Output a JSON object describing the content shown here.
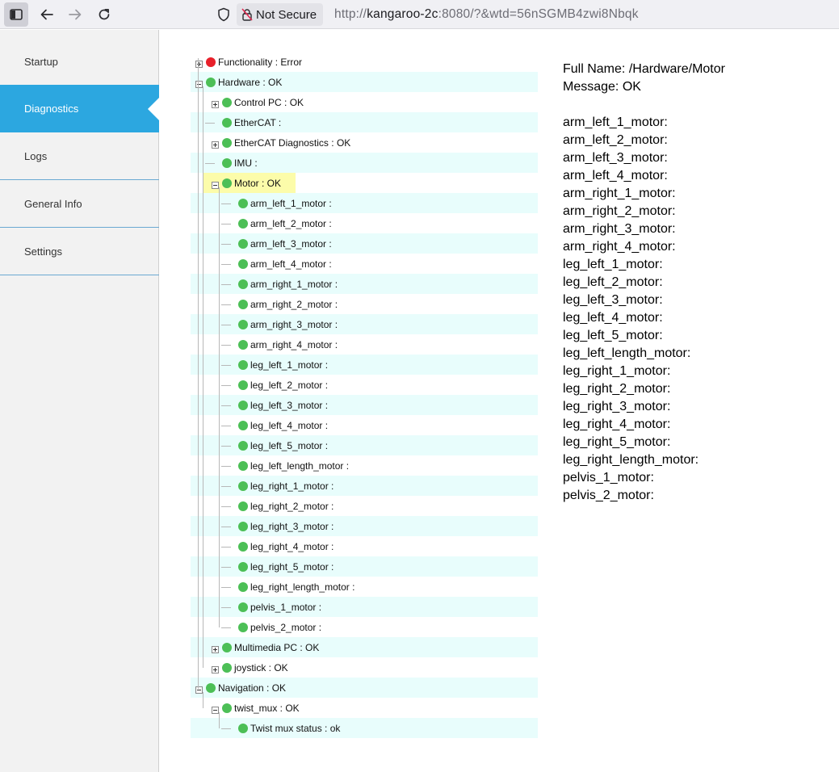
{
  "browser": {
    "security_label": "Not Secure",
    "url_prefix": "http://",
    "url_host": "kangaroo-2c",
    "url_rest": ":8080/?&wtd=56nSGMB4zwi8Nbqk"
  },
  "sidebar": {
    "items": [
      {
        "label": "Startup"
      },
      {
        "label": "Diagnostics"
      },
      {
        "label": "Logs"
      },
      {
        "label": "General Info"
      },
      {
        "label": "Settings"
      }
    ]
  },
  "tree": {
    "rows": [
      {
        "label": "Functionality : Error",
        "status": "error",
        "depth": 0,
        "toggle": "plus"
      },
      {
        "label": "Hardware : OK",
        "status": "ok",
        "depth": 0,
        "toggle": "minus"
      },
      {
        "label": "Control PC : OK",
        "status": "ok",
        "depth": 1,
        "toggle": "plus"
      },
      {
        "label": "EtherCAT :",
        "status": "ok",
        "depth": 1,
        "toggle": "none"
      },
      {
        "label": "EtherCAT Diagnostics : OK",
        "status": "ok",
        "depth": 1,
        "toggle": "plus"
      },
      {
        "label": "IMU :",
        "status": "ok",
        "depth": 1,
        "toggle": "none"
      },
      {
        "label": "Motor : OK",
        "status": "ok",
        "depth": 1,
        "toggle": "minus",
        "selected": true
      },
      {
        "label": "arm_left_1_motor :",
        "status": "ok",
        "depth": 2,
        "toggle": "none"
      },
      {
        "label": "arm_left_2_motor :",
        "status": "ok",
        "depth": 2,
        "toggle": "none"
      },
      {
        "label": "arm_left_3_motor :",
        "status": "ok",
        "depth": 2,
        "toggle": "none"
      },
      {
        "label": "arm_left_4_motor :",
        "status": "ok",
        "depth": 2,
        "toggle": "none"
      },
      {
        "label": "arm_right_1_motor :",
        "status": "ok",
        "depth": 2,
        "toggle": "none"
      },
      {
        "label": "arm_right_2_motor :",
        "status": "ok",
        "depth": 2,
        "toggle": "none"
      },
      {
        "label": "arm_right_3_motor :",
        "status": "ok",
        "depth": 2,
        "toggle": "none"
      },
      {
        "label": "arm_right_4_motor :",
        "status": "ok",
        "depth": 2,
        "toggle": "none"
      },
      {
        "label": "leg_left_1_motor :",
        "status": "ok",
        "depth": 2,
        "toggle": "none"
      },
      {
        "label": "leg_left_2_motor :",
        "status": "ok",
        "depth": 2,
        "toggle": "none"
      },
      {
        "label": "leg_left_3_motor :",
        "status": "ok",
        "depth": 2,
        "toggle": "none"
      },
      {
        "label": "leg_left_4_motor :",
        "status": "ok",
        "depth": 2,
        "toggle": "none"
      },
      {
        "label": "leg_left_5_motor :",
        "status": "ok",
        "depth": 2,
        "toggle": "none"
      },
      {
        "label": "leg_left_length_motor :",
        "status": "ok",
        "depth": 2,
        "toggle": "none"
      },
      {
        "label": "leg_right_1_motor :",
        "status": "ok",
        "depth": 2,
        "toggle": "none"
      },
      {
        "label": "leg_right_2_motor :",
        "status": "ok",
        "depth": 2,
        "toggle": "none"
      },
      {
        "label": "leg_right_3_motor :",
        "status": "ok",
        "depth": 2,
        "toggle": "none"
      },
      {
        "label": "leg_right_4_motor :",
        "status": "ok",
        "depth": 2,
        "toggle": "none"
      },
      {
        "label": "leg_right_5_motor :",
        "status": "ok",
        "depth": 2,
        "toggle": "none"
      },
      {
        "label": "leg_right_length_motor :",
        "status": "ok",
        "depth": 2,
        "toggle": "none"
      },
      {
        "label": "pelvis_1_motor :",
        "status": "ok",
        "depth": 2,
        "toggle": "none"
      },
      {
        "label": "pelvis_2_motor :",
        "status": "ok",
        "depth": 2,
        "toggle": "none"
      },
      {
        "label": "Multimedia PC : OK",
        "status": "ok",
        "depth": 1,
        "toggle": "plus"
      },
      {
        "label": "joystick : OK",
        "status": "ok",
        "depth": 1,
        "toggle": "plus"
      },
      {
        "label": "Navigation : OK",
        "status": "ok",
        "depth": 0,
        "toggle": "minus"
      },
      {
        "label": "twist_mux : OK",
        "status": "ok",
        "depth": 1,
        "toggle": "minus"
      },
      {
        "label": "Twist mux status : ok",
        "status": "ok",
        "depth": 2,
        "toggle": "none"
      }
    ]
  },
  "detail": {
    "full_name_label": "Full Name:",
    "full_name_value": "/Hardware/Motor",
    "message_label": "Message:",
    "message_value": "OK",
    "entries": [
      "arm_left_1_motor:",
      "arm_left_2_motor:",
      "arm_left_3_motor:",
      "arm_left_4_motor:",
      "arm_right_1_motor:",
      "arm_right_2_motor:",
      "arm_right_3_motor:",
      "arm_right_4_motor:",
      "leg_left_1_motor:",
      "leg_left_2_motor:",
      "leg_left_3_motor:",
      "leg_left_4_motor:",
      "leg_left_5_motor:",
      "leg_left_length_motor:",
      "leg_right_1_motor:",
      "leg_right_2_motor:",
      "leg_right_3_motor:",
      "leg_right_4_motor:",
      "leg_right_5_motor:",
      "leg_right_length_motor:",
      "pelvis_1_motor:",
      "pelvis_2_motor:"
    ]
  },
  "colors": {
    "accent": "#2ca7e0",
    "status_ok": "#4cbf56",
    "status_error": "#e8202a",
    "row_stripe": "#e8fdfc",
    "row_selected": "#fcfcaa"
  }
}
